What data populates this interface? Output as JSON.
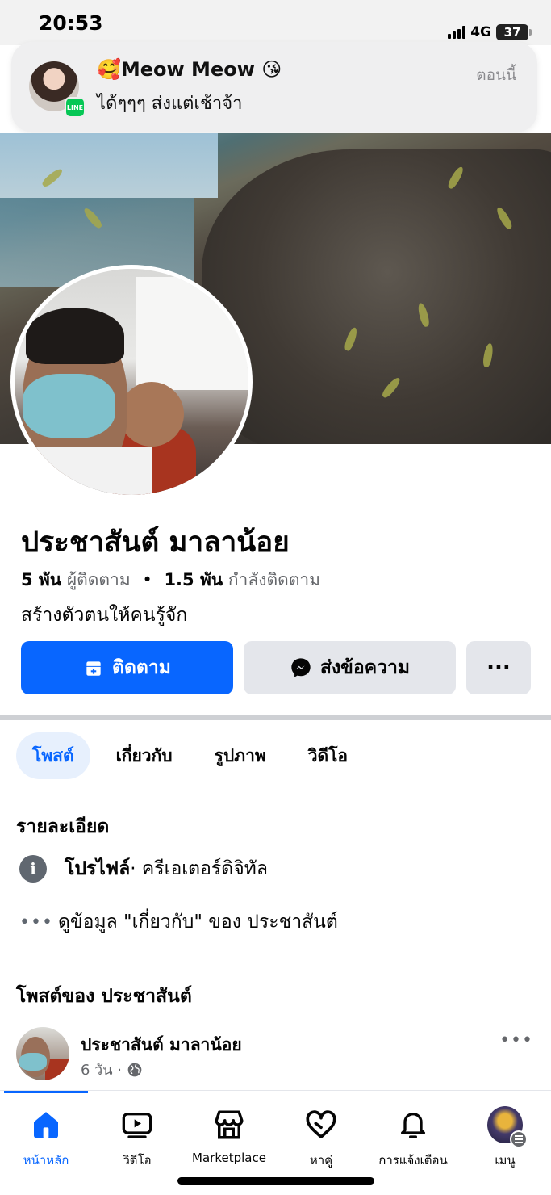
{
  "status_bar": {
    "time": "20:53",
    "network": "4G",
    "battery": "37"
  },
  "notification": {
    "app": "LINE",
    "title": "🥰Meow Meow 😘",
    "body": "ได้ๆๆๆ ส่งแต่เช้าจ้า",
    "time": "ตอนนี้"
  },
  "profile": {
    "name": "ประชาสันต์ มาลาน้อย",
    "followers_count": "5 พัน",
    "followers_label": "ผู้ติดตาม",
    "following_count": "1.5 พัน",
    "following_label": "กำลังติดตาม",
    "bio": "สร้างตัวตนให้คนรู้จัก"
  },
  "actions": {
    "follow": "ติดตาม",
    "message": "ส่งข้อความ",
    "more": "···"
  },
  "tabs": [
    {
      "label": "โพสต์",
      "active": true
    },
    {
      "label": "เกี่ยวกับ",
      "active": false
    },
    {
      "label": "รูปภาพ",
      "active": false
    },
    {
      "label": "วิดีโอ",
      "active": false
    }
  ],
  "details": {
    "title": "รายละเอียด",
    "profile_label": "โปรไฟล์",
    "profile_type": " · ครีเอเตอร์ดิจิทัล",
    "about_link": "ดูข้อมูล \"เกี่ยวกับ\" ของ ประชาสันต์"
  },
  "posts": {
    "title": "โพสต์ของ ประชาสันต์",
    "first": {
      "author": "ประชาสันต์ มาลาน้อย",
      "time": "6 วัน ·",
      "privacy_icon": "globe-icon"
    }
  },
  "bottom_nav": [
    {
      "label": "หน้าหลัก",
      "icon": "home-icon",
      "active": true
    },
    {
      "label": "วิดีโอ",
      "icon": "video-icon",
      "active": false
    },
    {
      "label": "Marketplace",
      "icon": "marketplace-icon",
      "active": false
    },
    {
      "label": "หาคู่",
      "icon": "dating-icon",
      "active": false
    },
    {
      "label": "การแจ้งเตือน",
      "icon": "bell-icon",
      "active": false
    },
    {
      "label": "เมนู",
      "icon": "menu-avatar",
      "active": false
    }
  ],
  "colors": {
    "primary": "#0866ff",
    "secondary_button": "#e4e6eb",
    "text_secondary": "#65676b"
  }
}
